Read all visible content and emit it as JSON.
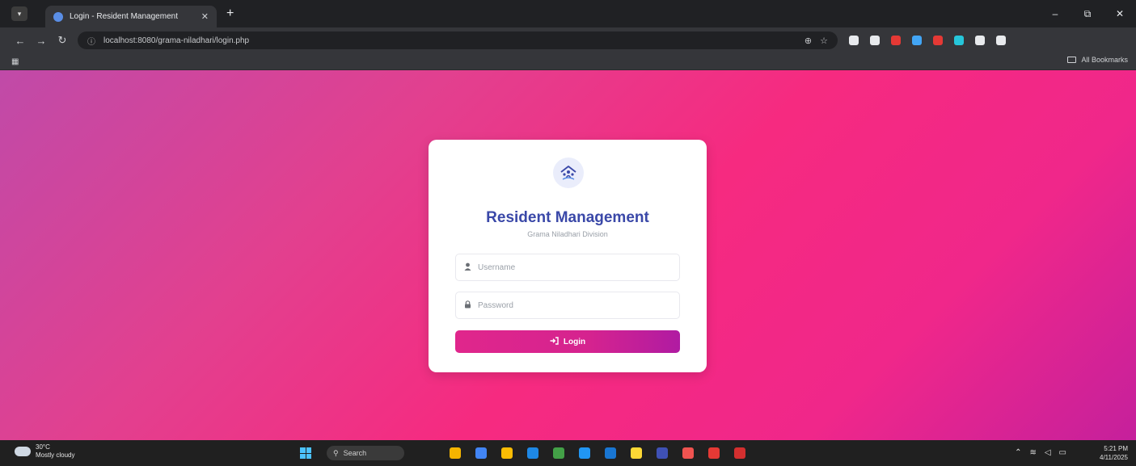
{
  "browser": {
    "tab_title": "Login - Resident Management",
    "tab_close": "✕",
    "new_tab": "+",
    "window_controls": {
      "minimize": "–",
      "restore": "⧉",
      "close": "✕"
    },
    "nav": {
      "back": "←",
      "forward": "→",
      "reload": "↻"
    },
    "url": "localhost:8080/grama-niladhari/login.php",
    "all_bookmarks": "All Bookmarks"
  },
  "login": {
    "title": "Resident Management",
    "subtitle": "Grama Niladhari Division",
    "username_placeholder": "Username",
    "password_placeholder": "Password",
    "button_label": "Login"
  },
  "taskbar": {
    "weather_temp": "30°C",
    "weather_desc": "Mostly cloudy",
    "search_label": "Search",
    "time": "5:21 PM",
    "date": "4/11/2025"
  },
  "colors": {
    "title": "#3a48a8",
    "button_start": "#e0268c",
    "button_end": "#b01ba2",
    "background_start": "#c04aa8",
    "background_mid": "#f62a80"
  },
  "icons": {
    "logo": "home-community-icon",
    "username": "user-icon",
    "password": "lock-icon",
    "button": "sign-in-icon"
  },
  "extension_colors": [
    "#e8eaed",
    "#e8eaed",
    "#e53935",
    "#42a5f5",
    "#e53935",
    "#26c6da",
    "#e8eaed",
    "#e8eaed"
  ],
  "taskbar_app_colors": [
    "#f4b400",
    "#4285f4",
    "#fbbc04",
    "#1e88e5",
    "#43a047",
    "#2196f3",
    "#1976d2",
    "#fdd835",
    "#3f51b5",
    "#ef5350",
    "#e53935",
    "#d32f2f"
  ]
}
